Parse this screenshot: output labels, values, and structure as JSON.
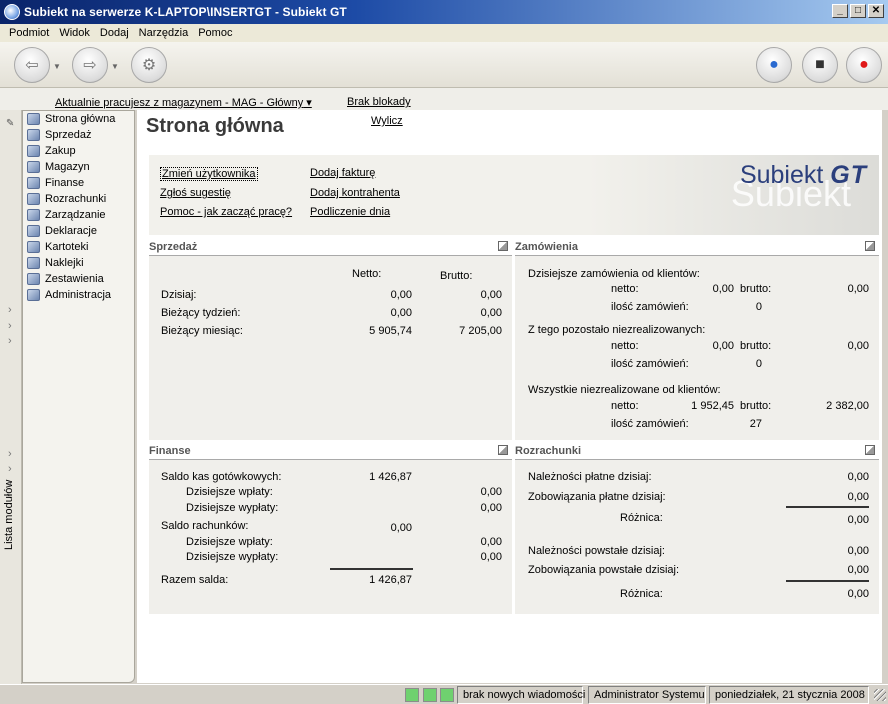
{
  "window": {
    "title": "Subiekt na serwerze K-LAPTOP\\INSERTGT - Subiekt GT",
    "min_glyph": "_",
    "max_glyph": "□",
    "close_glyph": "✕"
  },
  "menu": [
    "Podmiot",
    "Widok",
    "Dodaj",
    "Narzędzia",
    "Pomoc"
  ],
  "info": {
    "warehouse": "Aktualnie pracujesz z magazynem - MAG - Główny",
    "blockade": "Brak blokady"
  },
  "sidebar": {
    "vertical_label": "Lista modułów",
    "items": [
      {
        "label": "Strona główna",
        "icon": "home-icon"
      },
      {
        "label": "Sprzedaż",
        "icon": "sales-icon"
      },
      {
        "label": "Zakup",
        "icon": "purchase-icon"
      },
      {
        "label": "Magazyn",
        "icon": "warehouse-icon"
      },
      {
        "label": "Finanse",
        "icon": "finance-icon"
      },
      {
        "label": "Rozrachunki",
        "icon": "settlements-icon"
      },
      {
        "label": "Zarządzanie",
        "icon": "management-icon"
      },
      {
        "label": "Deklaracje",
        "icon": "declarations-icon"
      },
      {
        "label": "Kartoteki",
        "icon": "records-icon"
      },
      {
        "label": "Naklejki",
        "icon": "labels-icon"
      },
      {
        "label": "Zestawienia",
        "icon": "reports-icon"
      },
      {
        "label": "Administracja",
        "icon": "admin-icon"
      }
    ]
  },
  "main": {
    "title": "Strona główna",
    "wylicz": "Wylicz",
    "quick_links": {
      "change_user": "Zmień użytkownika",
      "suggestion": "Zgłoś sugestię",
      "help": "Pomoc - jak zacząć pracę?",
      "add_invoice": "Dodaj fakturę",
      "add_contractor": "Dodaj kontrahenta",
      "day_summary": "Podliczenie dnia"
    },
    "logo": {
      "main": "Subiekt",
      "suffix": "GT"
    }
  },
  "sprzedaz": {
    "header": "Sprzedaż",
    "col_netto": "Netto:",
    "col_brutto": "Brutto:",
    "rows": [
      {
        "label": "Dzisiaj:",
        "netto": "0,00",
        "brutto": "0,00"
      },
      {
        "label": "Bieżący tydzień:",
        "netto": "0,00",
        "brutto": "0,00"
      },
      {
        "label": "Bieżący miesiąc:",
        "netto": "5 905,74",
        "brutto": "7 205,00"
      }
    ]
  },
  "zamowienia": {
    "header": "Zamówienia",
    "label_netto": "netto:",
    "label_brutto": "brutto:",
    "label_count": "ilość zamówień:",
    "groups": [
      {
        "title": "Dzisiejsze zamówienia od klientów:",
        "netto": "0,00",
        "brutto": "0,00",
        "count": "0"
      },
      {
        "title": "Z tego pozostało niezrealizowanych:",
        "netto": "0,00",
        "brutto": "0,00",
        "count": "0"
      },
      {
        "title": "Wszystkie niezrealizowane od klientów:",
        "netto": "1 952,45",
        "brutto": "2 382,00",
        "count": "27"
      }
    ]
  },
  "finanse": {
    "header": "Finanse",
    "cash_label": "Saldo kas gotówkowych:",
    "cash_value": "1 426,87",
    "in_label": "Dzisiejsze wpłaty:",
    "out_label": "Dzisiejsze wypłaty:",
    "cash_in": "0,00",
    "cash_out": "0,00",
    "bank_label": "Saldo rachunków:",
    "bank_value": "0,00",
    "bank_in": "0,00",
    "bank_out": "0,00",
    "total_label": "Razem salda:",
    "total_value": "1 426,87"
  },
  "rozrachunki": {
    "header": "Rozrachunki",
    "rows": [
      {
        "label": "Należności płatne dzisiaj:",
        "value": "0,00"
      },
      {
        "label": "Zobowiązania płatne dzisiaj:",
        "value": "0,00"
      },
      {
        "label": "Różnica:",
        "value": "0,00"
      },
      {
        "label": "Należności powstałe dzisiaj:",
        "value": "0,00"
      },
      {
        "label": "Zobowiązania powstałe dzisiaj:",
        "value": "0,00"
      },
      {
        "label": "Różnica:",
        "value": "0,00"
      }
    ]
  },
  "status": {
    "messages": "brak nowych wiadomości",
    "user": "Administrator Systemu",
    "date": "poniedziałek, 21 stycznia 2008"
  }
}
